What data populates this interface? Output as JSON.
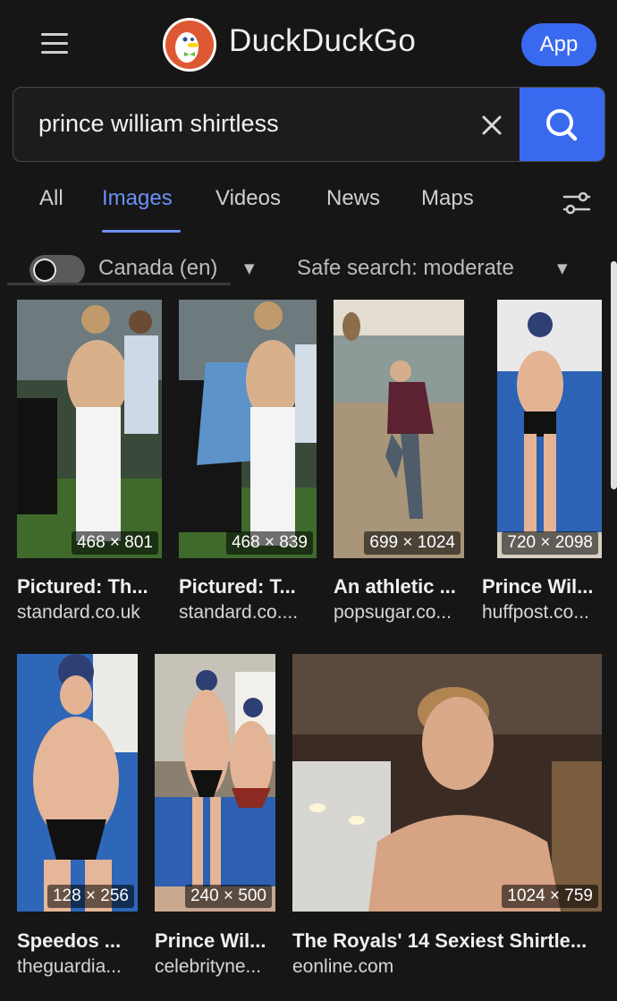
{
  "header": {
    "brand": "DuckDuckGo",
    "app_button": "App"
  },
  "search": {
    "query": "prince william shirtless"
  },
  "tabs": [
    {
      "label": "All"
    },
    {
      "label": "Images"
    },
    {
      "label": "Videos"
    },
    {
      "label": "News"
    },
    {
      "label": "Maps"
    }
  ],
  "filters": {
    "region": "Canada (en)",
    "safe_search": "Safe search: moderate"
  },
  "results": [
    {
      "dims": "468 × 801",
      "title": "Pictured: Th...",
      "source": "standard.co.uk"
    },
    {
      "dims": "468 × 839",
      "title": "Pictured: T...",
      "source": "standard.co...."
    },
    {
      "dims": "699 × 1024",
      "title": "An athletic ...",
      "source": "popsugar.co..."
    },
    {
      "dims": "720 × 2098",
      "title": "Prince Wil...",
      "source": "huffpost.co..."
    },
    {
      "dims": "128 × 256",
      "title": "Speedos ...",
      "source": "theguardia..."
    },
    {
      "dims": "240 × 500",
      "title": "Prince Wil...",
      "source": "celebrityne..."
    },
    {
      "dims": "1024 × 759",
      "title": "The Royals' 14 Sexiest Shirtle...",
      "source": "eonline.com"
    }
  ],
  "colors": {
    "background": "#161616",
    "accent": "#3969ef",
    "active_tab": "#6a90f5",
    "logo": "#de5833"
  },
  "icons": [
    "hamburger-icon",
    "duck-logo-icon",
    "close-icon",
    "search-icon",
    "filter-settings-icon",
    "chevron-down-icon"
  ]
}
